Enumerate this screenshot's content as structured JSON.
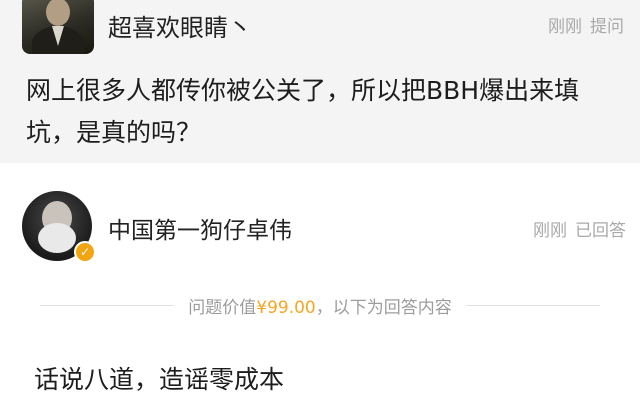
{
  "question": {
    "username": "超喜欢眼睛丶",
    "time": "刚刚",
    "action": "提问",
    "text": "网上很多人都传你被公关了，所以把BBH爆出来填坑，是真的吗？"
  },
  "answer": {
    "username": "中国第一狗仔卓伟",
    "time": "刚刚",
    "status": "已回答",
    "badge_icon": "v-badge-icon",
    "price_prefix": "问题价值",
    "price": "¥99.00",
    "price_suffix": "，以下为回答内容",
    "text": "话说八道，造谣零成本"
  },
  "colors": {
    "question_bg": "#f4f4f4",
    "price_accent": "#f5a623",
    "meta_gray": "#a9a9a9",
    "badge": "#f2a511"
  }
}
